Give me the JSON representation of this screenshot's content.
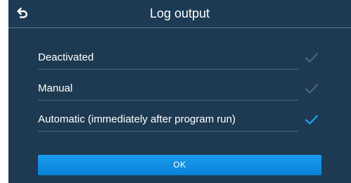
{
  "header": {
    "title": "Log output",
    "back_icon": "back-arrow-icon"
  },
  "options": [
    {
      "label": "Deactivated",
      "selected": false
    },
    {
      "label": "Manual",
      "selected": false
    },
    {
      "label": "Automatic (immediately after program run)",
      "selected": true
    }
  ],
  "ok_label": "OK",
  "colors": {
    "background": "#1e3a52",
    "accent": "#1a9cf0",
    "check_inactive": "#4f6679",
    "check_active": "#1aa3f5"
  }
}
